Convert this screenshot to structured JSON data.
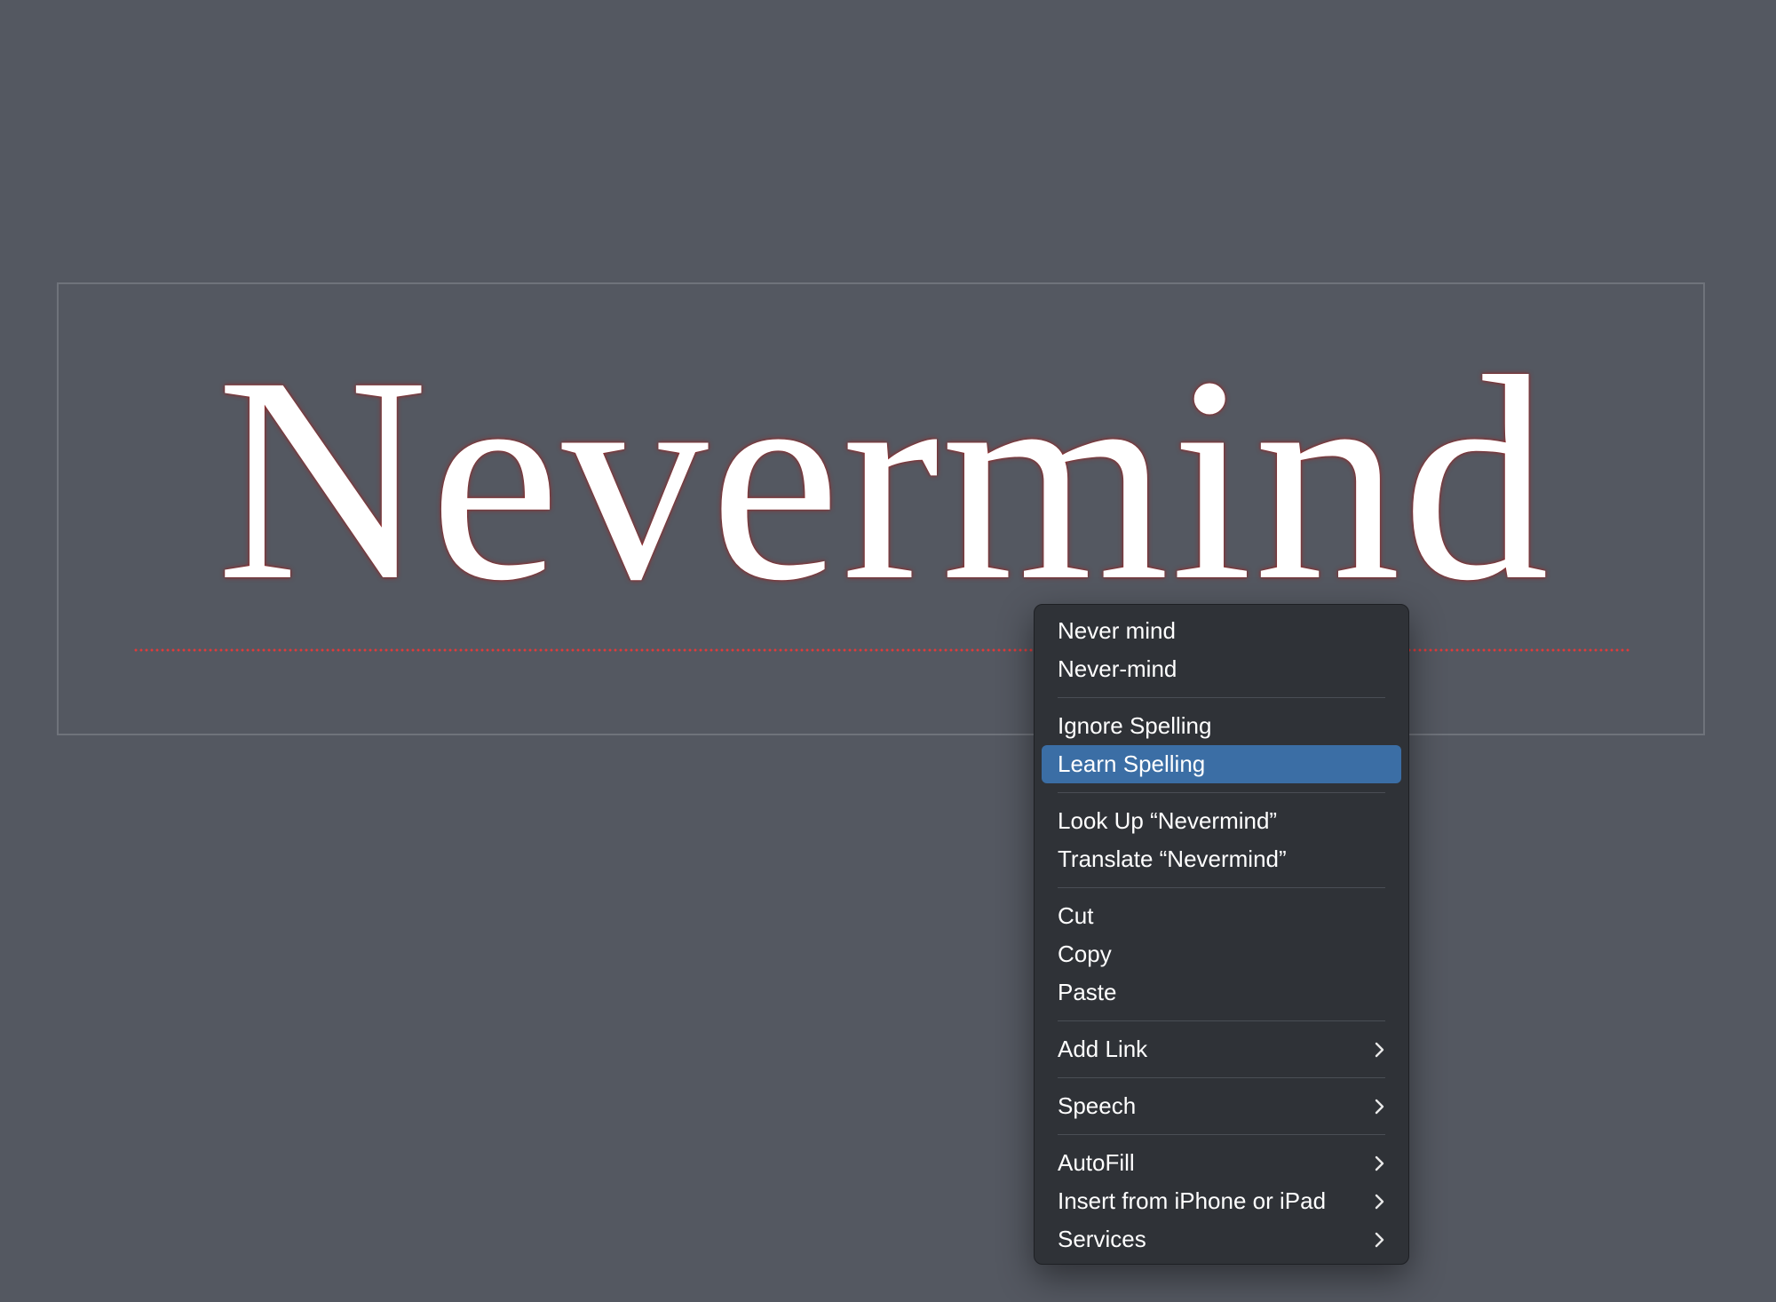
{
  "document": {
    "word": "Nevermind"
  },
  "context_menu": {
    "groups": [
      {
        "items": [
          {
            "label": "Never mind"
          },
          {
            "label": "Never-mind"
          }
        ]
      },
      {
        "items": [
          {
            "label": "Ignore Spelling"
          },
          {
            "label": "Learn Spelling",
            "highlighted": true
          }
        ]
      },
      {
        "items": [
          {
            "label": "Look Up “Nevermind”"
          },
          {
            "label": "Translate “Nevermind”"
          }
        ]
      },
      {
        "items": [
          {
            "label": "Cut"
          },
          {
            "label": "Copy"
          },
          {
            "label": "Paste"
          }
        ]
      },
      {
        "items": [
          {
            "label": "Add Link",
            "submenu": true
          }
        ]
      },
      {
        "items": [
          {
            "label": "Speech",
            "submenu": true
          }
        ]
      },
      {
        "items": [
          {
            "label": "AutoFill",
            "submenu": true
          },
          {
            "label": "Insert from iPhone or iPad",
            "submenu": true
          },
          {
            "label": "Services",
            "submenu": true
          }
        ]
      }
    ]
  },
  "colors": {
    "background": "#545861",
    "menu_background": "#2f3237",
    "highlight": "#3b6ea5",
    "spelling_underline": "#e03a3a"
  }
}
